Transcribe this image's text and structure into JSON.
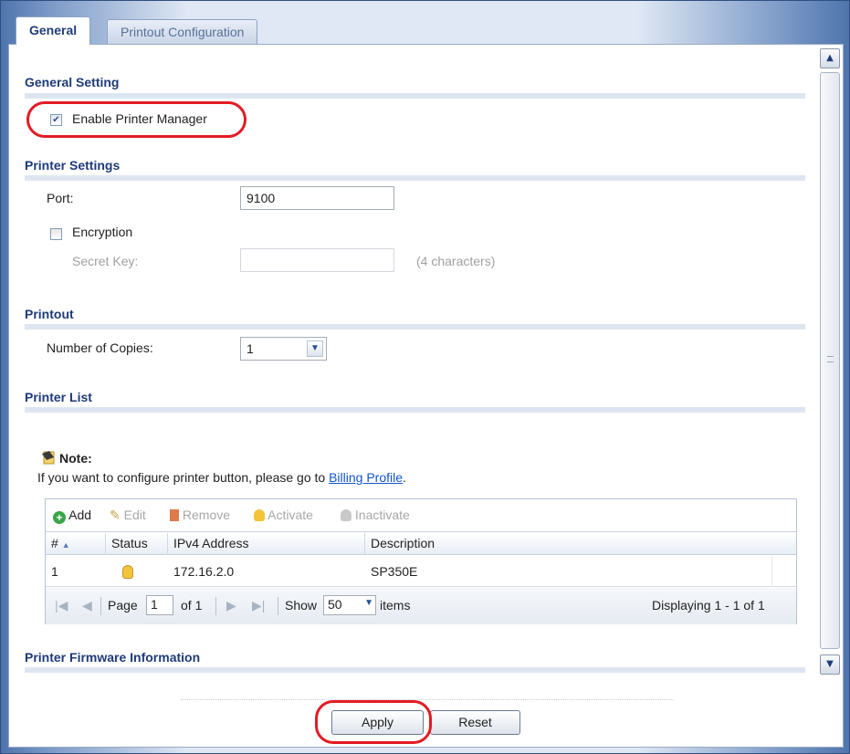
{
  "tabs": [
    {
      "label": "General",
      "active": true
    },
    {
      "label": "Printout Configuration",
      "active": false
    }
  ],
  "general_setting": {
    "title": "General Setting",
    "enable_printer_manager": {
      "label": "Enable Printer Manager",
      "checked": true
    }
  },
  "printer_settings": {
    "title": "Printer Settings",
    "port_label": "Port:",
    "port_value": "9100",
    "encryption": {
      "label": "Encryption",
      "checked": false
    },
    "secret_key_label": "Secret Key:",
    "secret_key_value": "",
    "secret_key_hint": "(4 characters)"
  },
  "printout": {
    "title": "Printout",
    "copies_label": "Number of Copies:",
    "copies_value": "1"
  },
  "printer_list": {
    "title": "Printer List",
    "note_title": "Note:",
    "note_text": "If you want to configure printer button, please go to ",
    "note_link": "Billing Profile",
    "note_end": ".",
    "toolbar": {
      "add": "Add",
      "edit": "Edit",
      "remove": "Remove",
      "activate": "Activate",
      "inactivate": "Inactivate"
    },
    "columns": [
      "#",
      "Status",
      "IPv4 Address",
      "Description"
    ],
    "rows": [
      {
        "index": "1",
        "status": "active",
        "ipv4": "172.16.2.0",
        "description": "SP350E"
      }
    ],
    "pager": {
      "page_label": "Page",
      "page_value": "1",
      "of_label": "of 1",
      "show_label": "Show",
      "show_value": "50",
      "items_label": "items",
      "displaying": "Displaying 1 - 1 of 1"
    }
  },
  "firmware": {
    "title": "Printer Firmware Information"
  },
  "buttons": {
    "apply": "Apply",
    "reset": "Reset"
  },
  "colors": {
    "accent": "#1e3a78",
    "highlight_ring": "#e31b23",
    "link": "#1255cc"
  }
}
